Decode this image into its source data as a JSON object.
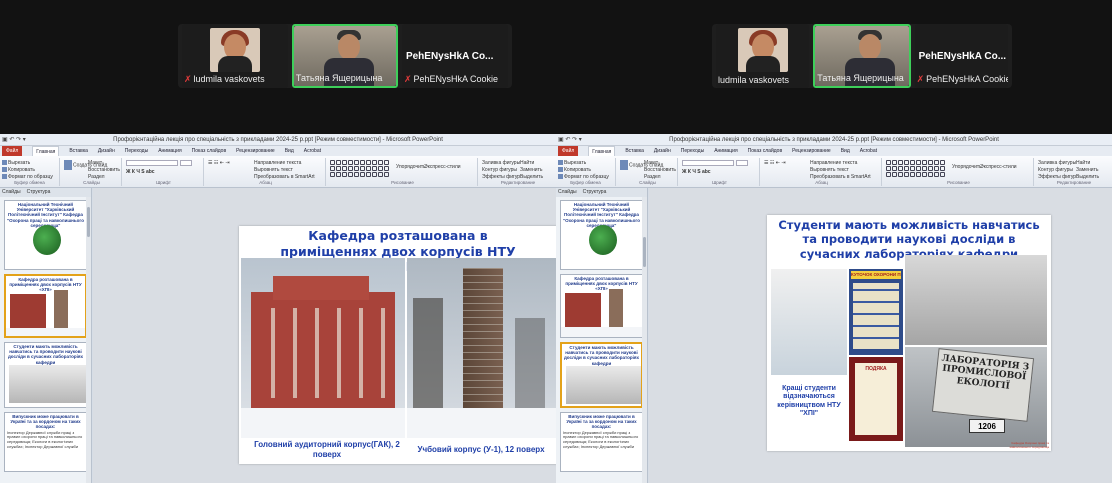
{
  "participants": {
    "p1": {
      "name": "ludmila vaskovets"
    },
    "p2": {
      "name": "Татьяна Ящерицына"
    },
    "p3": {
      "display": "PehENysHkA  Co...",
      "name": "PehENysHkA Cookie"
    }
  },
  "ppt": {
    "title_left": "Профорієнтаційна лекція про  спеціальність з прикладами 2024-25 р.ppt [Режим совместимости] - Microsoft PowerPoint",
    "title_right": "Профорієнтаційна лекція про  спеціальність з прикладами 2024-25 р.ppt [Режим совместимости] - Microsoft PowerPoint",
    "tabs": [
      "Файл",
      "Главная",
      "Вставка",
      "Дизайн",
      "Переходы",
      "Анимация",
      "Показ слайдов",
      "Рецензирование",
      "Вид",
      "Acrobat"
    ],
    "ribbon": {
      "clipboard": {
        "label": "Буфер обмена",
        "cut": "Вырезать",
        "copy": "Копировать",
        "format": "Формат по образцу",
        "paste": "Вставить"
      },
      "slides": {
        "label": "Слайды",
        "create": "Создать слайд",
        "layout": "Макет",
        "reset": "Восстановить",
        "section": "Раздел"
      },
      "font": {
        "label": "Шрифт"
      },
      "paragraph": {
        "label": "Абзац",
        "dir": "Направление текста",
        "align": "Выровнять текст",
        "smartart": "Преобразовать в SmartArt"
      },
      "drawing": {
        "label": "Рисование",
        "arrange": "Упорядочить",
        "quick": "Экспресс-стили",
        "fill": "Заливка фигуры",
        "outline": "Контур фигуры",
        "effects": "Эффекты фигур"
      },
      "editing": {
        "label": "Редактирование",
        "find": "Найти",
        "replace": "Заменить",
        "select": "Выделить"
      }
    },
    "pane_tabs": [
      "Слайды",
      "Структура"
    ]
  },
  "thumbs": {
    "t1_title": "Національний Технічний Університет \"Харківський Політехнічний Інститут\" Кафедра \"Охорона праці та навколишнього середовища\"",
    "t2_title": "Кафедра розташована в приміщеннях двох корпусів НТУ «ХПІ»",
    "t3_title": "Студенти мають можливість навчатись та проводити наукові досліди в сучасних лабораторіях кафедри",
    "t4_title": "Випускник може працювати в Україні та за кордоном на таких посадах:",
    "t4_text": "Інспектор Державної служби праці з правил охорони праці та навколишнього середовища; Екологи в екологічних службах; Інспектор Державної служби"
  },
  "slide_left": {
    "title": "Кафедра розташована в приміщеннях двох корпусів НТУ «ХПІ»",
    "caption_left": "Головний аудиторний корпус(ГАК), 2 поверх",
    "caption_right": "Учбовий корпус (У-1), 12 поверх"
  },
  "slide_right": {
    "title": "Студенти мають можливість навчатись та проводити наукові досліди в сучасних лабораторіях кафедри",
    "banner": "КУТОЧОК ОХОРОНИ ПРАЦІ ТА ПОЖЕЖ",
    "caption": "Кращі студенти відзначаються керівництвом НТУ \"ХПІ\"",
    "sign": "ЛАБОРАТОРІЯ З ПРОМИСЛОВОЇ ЕКОЛОГІЇ",
    "room": "1206",
    "award": "ПОДЯКА",
    "footer": "Кафедра Охорони праці та навколишнього середовища"
  },
  "colors": {
    "active_border": "#3ecf5a",
    "title_blue": "#1f3fa8",
    "file_tab": "#c0392b"
  }
}
